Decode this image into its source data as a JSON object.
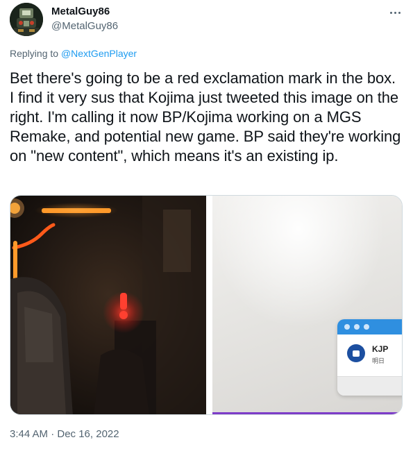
{
  "author": {
    "display_name": "MetalGuy86",
    "handle": "@MetalGuy86",
    "avatar_icon": "robot-mech-avatar"
  },
  "menu": {
    "icon": "more-horizontal-icon"
  },
  "reply_context": {
    "prefix": "Replying to",
    "target": "@NextGenPlayer"
  },
  "tweet_text": "Bet there's going to be a red exclamation mark in the box. I find it very sus that Kojima just tweeted this image on the right. I'm calling it now BP/Kojima working on a MGS Remake, and potential new game. BP said they're working on \"new content\", which means it's an existing ip.",
  "media": {
    "left_image": "dark-scene-red-exclamation-mark",
    "right_image": "white-surface-kjp-app-window",
    "right_card": {
      "title": "KJP",
      "subtitle": "明日"
    }
  },
  "timestamp": "3:44 AM · Dec 16, 2022",
  "colors": {
    "link": "#1d9bf0",
    "secondary_text": "#536471",
    "primary_text": "#0f1419",
    "orange_light": "#ff8a1a",
    "red_light": "#e8332a"
  }
}
